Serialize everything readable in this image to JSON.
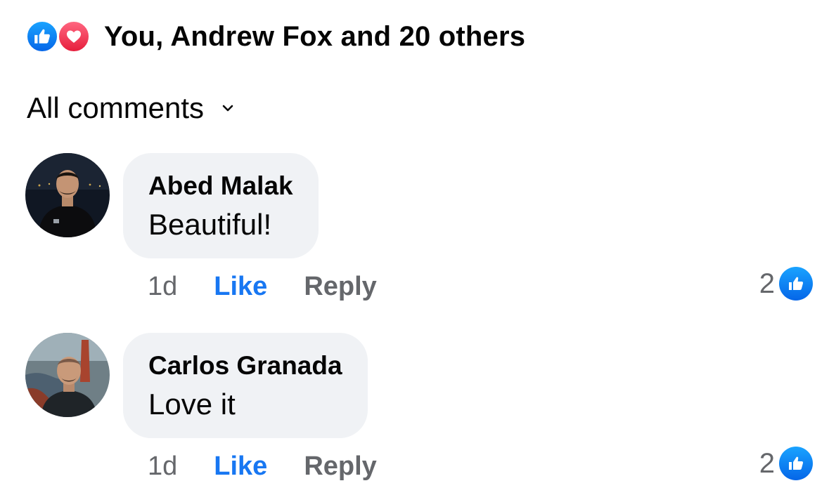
{
  "reactions": {
    "summary": "You, Andrew Fox and 20 others",
    "icons": [
      "like-icon",
      "love-icon"
    ],
    "like_color": "#1877f2",
    "love_color": "#f33e58"
  },
  "filter": {
    "label": "All comments",
    "icon": "chevron-down-icon"
  },
  "comments": [
    {
      "author": "Abed Malak",
      "text": "Beautiful!",
      "time": "1d",
      "like_label": "Like",
      "reply_label": "Reply",
      "reaction_count": "2"
    },
    {
      "author": "Carlos Granada",
      "text": "Love it",
      "time": "1d",
      "like_label": "Like",
      "reply_label": "Reply",
      "reaction_count": "2"
    }
  ],
  "colors": {
    "bubble": "#f0f2f5",
    "secondary_text": "#65676b",
    "link_blue": "#1877f2"
  }
}
